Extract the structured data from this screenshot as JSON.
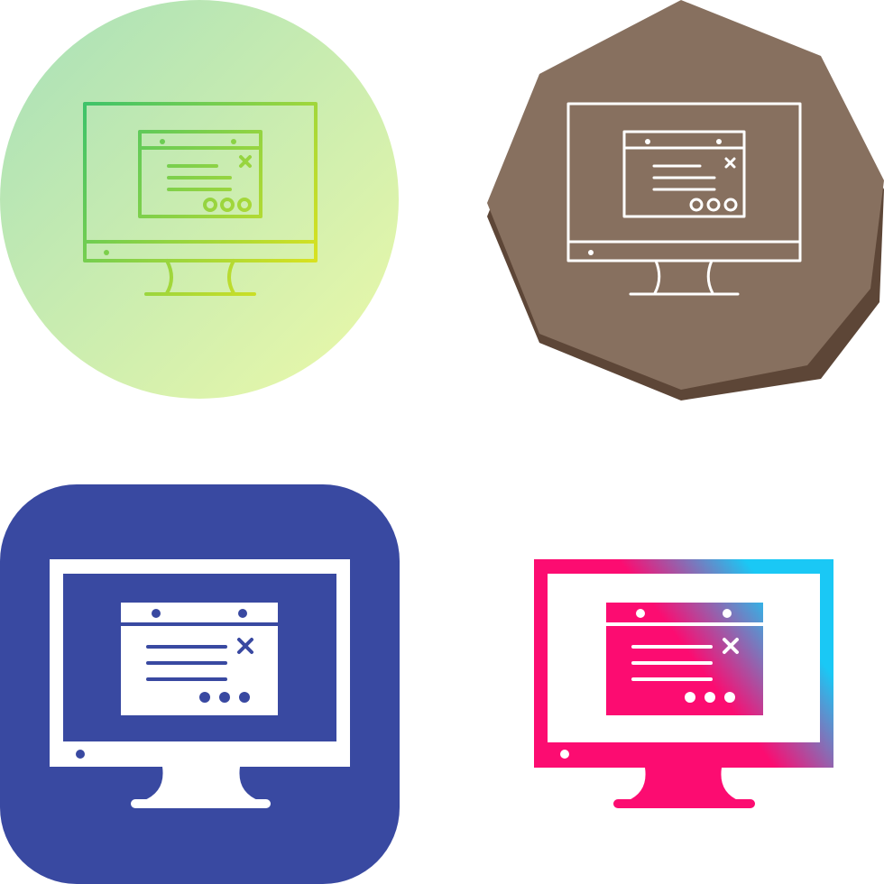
{
  "icons": [
    {
      "name": "computer-window-gradient-line-icon",
      "style": "gradient-line",
      "background": "circle",
      "colors": {
        "bg_start": "#a8e0b8",
        "bg_end": "#ecf9a8",
        "line_start": "#3dc36a",
        "line_end": "#e6e41a"
      }
    },
    {
      "name": "computer-window-white-line-icon",
      "style": "line",
      "background": "octagon",
      "colors": {
        "bg": "#87705f",
        "bg_shadow": "#5d4637",
        "line": "#ffffff"
      }
    },
    {
      "name": "computer-window-glyph-icon",
      "style": "glyph",
      "background": "rounded-square",
      "colors": {
        "bg": "#3949a1",
        "fill": "#ffffff",
        "detail": "#3949a1"
      }
    },
    {
      "name": "computer-window-gradient-glyph-icon",
      "style": "gradient-glyph",
      "background": "none",
      "colors": {
        "fill_start": "#fc0c71",
        "fill_end": "#1ac8f5",
        "detail": "#ffffff"
      }
    }
  ]
}
